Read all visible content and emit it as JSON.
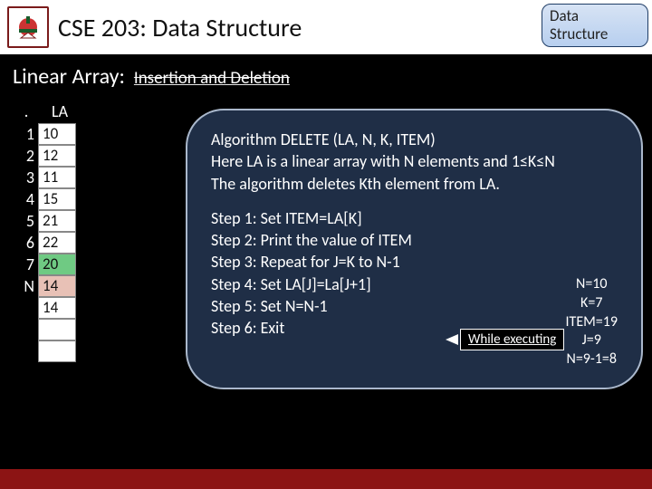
{
  "header": {
    "course_title": "CSE 203: Data Structure",
    "badge": "Data Structure"
  },
  "subheader": {
    "main": "Linear Array:",
    "sub": "Insertion and Deletion"
  },
  "array": {
    "header_dot": ".",
    "header_la": "LA",
    "rows": [
      {
        "idx": "1",
        "val": "10",
        "cls": ""
      },
      {
        "idx": "2",
        "val": "12",
        "cls": ""
      },
      {
        "idx": "3",
        "val": "11",
        "cls": ""
      },
      {
        "idx": "4",
        "val": "15",
        "cls": ""
      },
      {
        "idx": "5",
        "val": "21",
        "cls": ""
      },
      {
        "idx": "6",
        "val": "22",
        "cls": ""
      },
      {
        "idx": "7",
        "val": "20",
        "cls": "green"
      },
      {
        "idx": "N",
        "val": "14",
        "cls": "pink"
      },
      {
        "idx": "",
        "val": "14",
        "cls": ""
      },
      {
        "idx": "",
        "val": "",
        "cls": "empty"
      },
      {
        "idx": "",
        "val": "",
        "cls": "empty"
      }
    ]
  },
  "algo": {
    "line1": "Algorithm DELETE (LA, N, K, ITEM)",
    "line2": "Here LA is a linear array with N elements and 1≤K≤N",
    "line3": "The algorithm deletes Kth element from LA.",
    "step1": "Step 1: Set ITEM=LA[K]",
    "step2": "Step 2: Print the value of ITEM",
    "step3": "Step 3: Repeat for J=K to N-1",
    "step4": "Step 4: Set LA[J]=La[J+1]",
    "step5": "Step 5: Set N=N-1",
    "step6": "Step 6: Exit",
    "while_label": "While executing",
    "vars": {
      "n": "N=10",
      "k": "K=7",
      "item": "ITEM=19",
      "j": "J=9",
      "nres": "N=9-1=8"
    }
  },
  "colors": {
    "accent_red": "#8c1414",
    "box_bg": "#1f2e46"
  }
}
